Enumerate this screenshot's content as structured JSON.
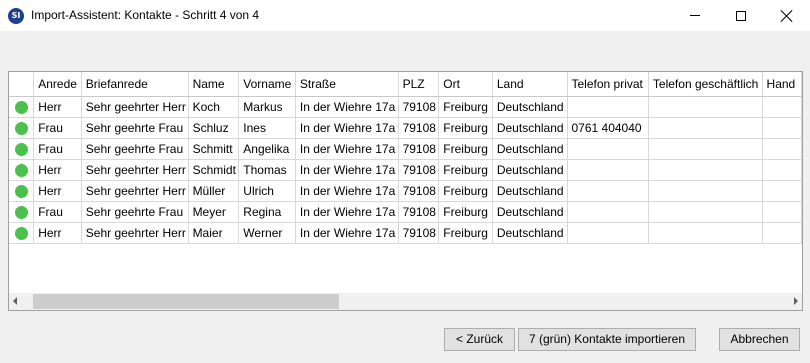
{
  "window": {
    "title": "Import-Assistent: Kontakte - Schritt 4 von 4",
    "icon_text": "SI"
  },
  "table": {
    "columns": [
      "",
      "Anrede",
      "Briefanrede",
      "Name",
      "Vorname",
      "Straße",
      "PLZ",
      "Ort",
      "Land",
      "Telefon privat",
      "Telefon geschäftlich",
      "Handy"
    ],
    "column_visible_text": [
      "",
      "Anrede",
      "Briefanrede",
      "Name",
      "Vorname",
      "Straße",
      "PLZ",
      "Ort",
      "Land",
      "Telefon privat",
      "Telefon geschäftlich",
      "Hand"
    ],
    "status_color": "#4cc04c",
    "rows": [
      {
        "anrede": "Herr",
        "briefanrede": "Sehr geehrter Herr",
        "name": "Koch",
        "vorname": "Markus",
        "strasse": "In der Wiehre 17a",
        "plz": "79108",
        "ort": "Freiburg",
        "land": "Deutschland",
        "telefon_privat": "",
        "telefon_geschaeftlich": "",
        "handy": ""
      },
      {
        "anrede": "Frau",
        "briefanrede": "Sehr geehrte Frau",
        "name": "Schluz",
        "vorname": "Ines",
        "strasse": "In der Wiehre 17a",
        "plz": "79108",
        "ort": "Freiburg",
        "land": "Deutschland",
        "telefon_privat": "0761 404040",
        "telefon_geschaeftlich": "",
        "handy": ""
      },
      {
        "anrede": "Frau",
        "briefanrede": "Sehr geehrte Frau",
        "name": "Schmitt",
        "vorname": "Angelika",
        "strasse": "In der Wiehre 17a",
        "plz": "79108",
        "ort": "Freiburg",
        "land": "Deutschland",
        "telefon_privat": "",
        "telefon_geschaeftlich": "",
        "handy": ""
      },
      {
        "anrede": "Herr",
        "briefanrede": "Sehr geehrter Herr",
        "name": "Schmidt",
        "vorname": "Thomas",
        "strasse": "In der Wiehre 17a",
        "plz": "79108",
        "ort": "Freiburg",
        "land": "Deutschland",
        "telefon_privat": "",
        "telefon_geschaeftlich": "",
        "handy": ""
      },
      {
        "anrede": "Herr",
        "briefanrede": "Sehr geehrter Herr",
        "name": "Müller",
        "vorname": "Ulrich",
        "strasse": "In der Wiehre 17a",
        "plz": "79108",
        "ort": "Freiburg",
        "land": "Deutschland",
        "telefon_privat": "",
        "telefon_geschaeftlich": "",
        "handy": ""
      },
      {
        "anrede": "Frau",
        "briefanrede": "Sehr geehrte Frau",
        "name": "Meyer",
        "vorname": "Regina",
        "strasse": "In der Wiehre 17a",
        "plz": "79108",
        "ort": "Freiburg",
        "land": "Deutschland",
        "telefon_privat": "",
        "telefon_geschaeftlich": "",
        "handy": ""
      },
      {
        "anrede": "Herr",
        "briefanrede": "Sehr geehrter Herr",
        "name": "Maier",
        "vorname": "Werner",
        "strasse": "In der Wiehre 17a",
        "plz": "79108",
        "ort": "Freiburg",
        "land": "Deutschland",
        "telefon_privat": "",
        "telefon_geschaeftlich": "",
        "handy": ""
      }
    ]
  },
  "buttons": {
    "back": "< Zurück",
    "import": "7 (grün) Kontakte importieren",
    "cancel": "Abbrechen"
  }
}
